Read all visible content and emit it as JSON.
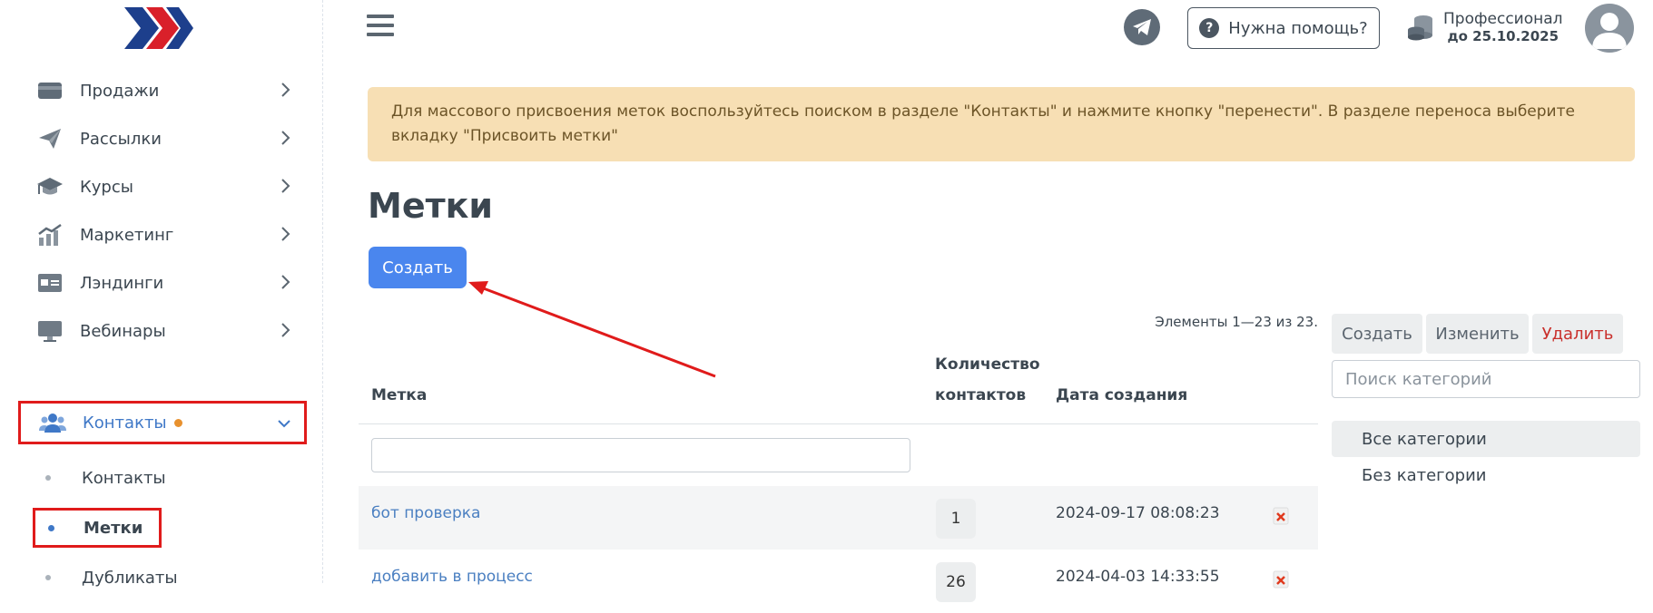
{
  "sidebar": {
    "items": [
      {
        "label": "Продажи",
        "icon": "wallet-icon"
      },
      {
        "label": "Рассылки",
        "icon": "paper-plane-icon"
      },
      {
        "label": "Курсы",
        "icon": "graduation-cap-icon"
      },
      {
        "label": "Маркетинг",
        "icon": "growth-chart-icon"
      },
      {
        "label": "Лэндинги",
        "icon": "id-card-icon"
      },
      {
        "label": "Вебинары",
        "icon": "monitor-icon"
      },
      {
        "label": "Контакты",
        "icon": "users-icon"
      }
    ],
    "subitems": [
      {
        "label": "Контакты"
      },
      {
        "label": "Метки"
      },
      {
        "label": "Дубликаты"
      }
    ]
  },
  "header": {
    "help_label": "Нужна помощь?",
    "plan_name": "Профессионал",
    "plan_until": "до 25.10.2025"
  },
  "alert": {
    "text": "Для массового присвоения меток воспользуйтесь поиском в разделе \"Контакты\" и нажмите кнопку \"перенести\". В разделе переноса выберите вкладку \"Присвоить метки\""
  },
  "main": {
    "title": "Метки",
    "create_label": "Создать",
    "count_info": "Элементы 1—23 из 23."
  },
  "table": {
    "headers": {
      "name": "Метка",
      "count_line1": "Количество",
      "count_line2": "контактов",
      "date": "Дата создания"
    },
    "rows": [
      {
        "name": "бот проверка",
        "count": "1",
        "date": "2024-09-17 08:08:23"
      },
      {
        "name": "добавить в процесс",
        "count": "26",
        "date": "2024-04-03 14:33:55"
      }
    ]
  },
  "categories": {
    "create_label": "Создать",
    "edit_label": "Изменить",
    "delete_label": "Удалить",
    "search_placeholder": "Поиск категорий",
    "items": [
      {
        "label": "Все категории"
      },
      {
        "label": "Без категории"
      }
    ]
  },
  "colors": {
    "accent": "#4a86ee",
    "highlight_box": "#e01b1b",
    "alert_bg": "#f7dfb4",
    "delete_text": "#c9302c"
  }
}
